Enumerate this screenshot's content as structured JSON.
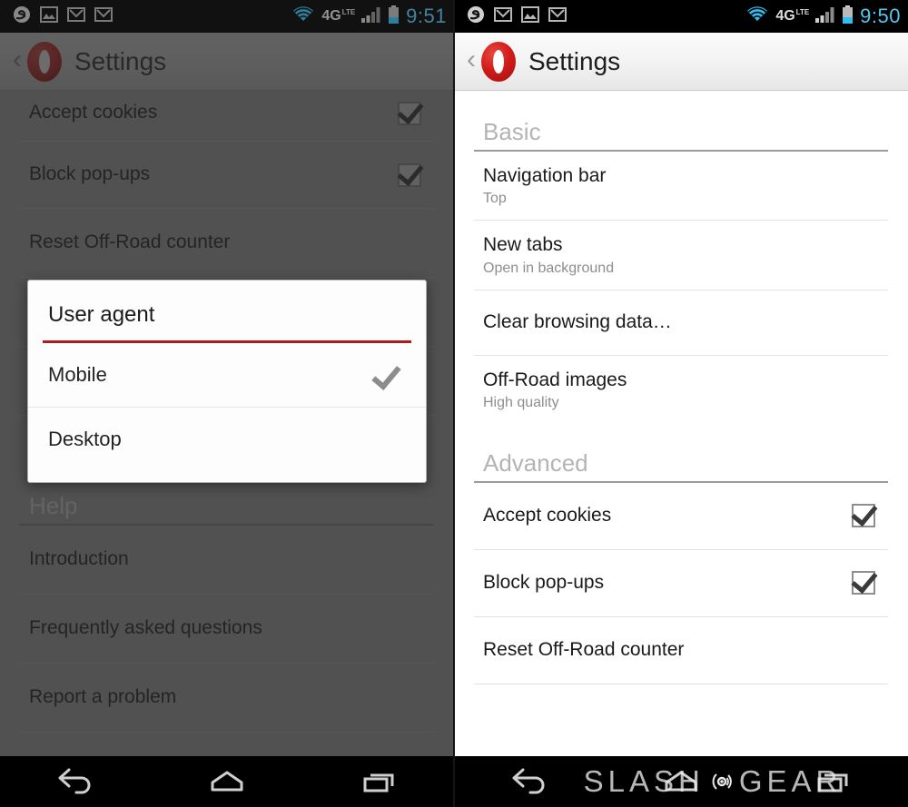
{
  "left": {
    "statusbar": {
      "icons": [
        "skype-icon",
        "gallery-icon",
        "gmail-icon",
        "gmail-icon"
      ],
      "network_label": "4G",
      "network_sub": "LTE",
      "clock": "9:51"
    },
    "header": {
      "back_label": "‹",
      "logo": "opera-logo",
      "title": "Settings"
    },
    "rows": [
      {
        "title": "Accept cookies",
        "sub": "",
        "checkbox": true
      },
      {
        "title": "Block pop-ups",
        "sub": "",
        "checkbox": true
      },
      {
        "title": "Reset Off-Road counter",
        "sub": "",
        "checkbox": null
      }
    ],
    "help_section": {
      "header": "Help",
      "rows": [
        {
          "title": "Introduction"
        },
        {
          "title": "Frequently asked questions"
        },
        {
          "title": "Report a problem"
        }
      ]
    },
    "dialog": {
      "title": "User agent",
      "options": [
        {
          "label": "Mobile",
          "selected": true
        },
        {
          "label": "Desktop",
          "selected": false
        }
      ],
      "accent_color": "#b1191b"
    },
    "navbar": {
      "back": "back-icon",
      "home": "home-icon",
      "recents": "recents-icon"
    }
  },
  "right": {
    "statusbar": {
      "icons": [
        "skype-icon",
        "gmail-icon",
        "gallery-icon",
        "gmail-icon"
      ],
      "network_label": "4G",
      "network_sub": "LTE",
      "clock": "9:50"
    },
    "header": {
      "back_label": "‹",
      "logo": "opera-logo",
      "title": "Settings"
    },
    "sections": [
      {
        "header": "Basic",
        "rows": [
          {
            "title": "Navigation bar",
            "sub": "Top",
            "checkbox": null
          },
          {
            "title": "New tabs",
            "sub": "Open in background",
            "checkbox": null
          },
          {
            "title": "Clear browsing data…",
            "sub": "",
            "checkbox": null
          },
          {
            "title": "Off-Road images",
            "sub": "High quality",
            "checkbox": null
          }
        ]
      },
      {
        "header": "Advanced",
        "rows": [
          {
            "title": "Accept cookies",
            "sub": "",
            "checkbox": true
          },
          {
            "title": "Block pop-ups",
            "sub": "",
            "checkbox": true
          },
          {
            "title": "Reset Off-Road counter",
            "sub": "",
            "checkbox": null
          }
        ]
      }
    ],
    "navbar": {
      "back": "back-icon",
      "home": "home-icon",
      "recents": "recents-icon",
      "watermark_left": "SLASH",
      "watermark_right": "GEAR"
    }
  },
  "colors": {
    "accent_red": "#b1191b",
    "opera_red": "#d31c1c",
    "status_blue": "#53c7ef",
    "scrim": "rgba(40,40,40,0.42)"
  }
}
